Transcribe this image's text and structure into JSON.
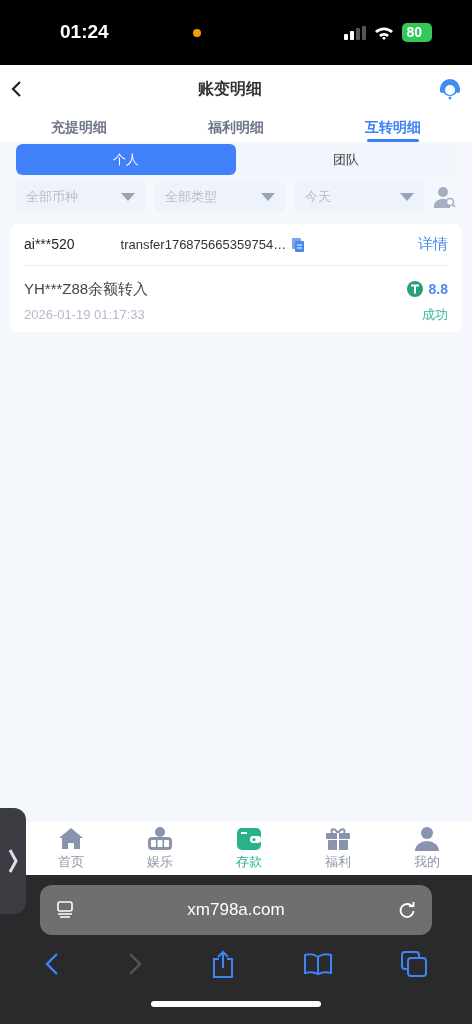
{
  "status_bar": {
    "time": "01:24",
    "battery": "80"
  },
  "header": {
    "title": "账变明细"
  },
  "tabs": [
    {
      "label": "充提明细",
      "selected": false
    },
    {
      "label": "福利明细",
      "selected": false
    },
    {
      "label": "互转明细",
      "selected": true
    }
  ],
  "segments": [
    {
      "label": "个人",
      "selected": true
    },
    {
      "label": "团队",
      "selected": false
    }
  ],
  "filters": [
    {
      "placeholder": "全部币种"
    },
    {
      "placeholder": "全部类型"
    },
    {
      "placeholder": "今天"
    }
  ],
  "records": [
    {
      "user": "ai***520",
      "order_no": "transfer176875665359754…",
      "details_link": "详情",
      "description": "YH***Z88余额转入",
      "amount": "8.8",
      "time": "2026-01-19 01:17:33",
      "status": "成功"
    }
  ],
  "bottom_nav": [
    {
      "label": "首页",
      "kind": "home",
      "selected": false
    },
    {
      "label": "娱乐",
      "kind": "games",
      "selected": false
    },
    {
      "label": "存款",
      "kind": "wallet",
      "selected": true
    },
    {
      "label": "福利",
      "kind": "gift",
      "selected": false
    },
    {
      "label": "我的",
      "kind": "profile",
      "selected": false
    }
  ],
  "browser": {
    "url": "xm798a.com"
  }
}
